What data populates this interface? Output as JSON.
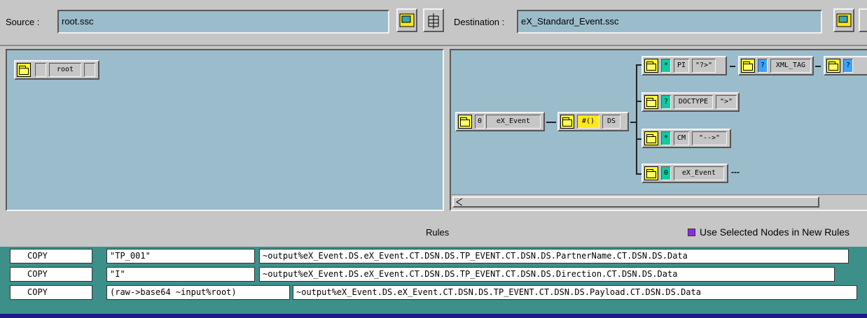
{
  "source": {
    "label": "Source :",
    "value": "root.ssc"
  },
  "destination": {
    "label": "Destination :",
    "value": "eX_Standard_Event.ssc"
  },
  "source_tree": {
    "root_label": "root"
  },
  "dest_tree": {
    "root": {
      "count": "0",
      "label": "eX_Event"
    },
    "ds": {
      "mark": "#()",
      "label": "DS"
    },
    "pi": {
      "mark": "*",
      "label": "PI",
      "value": "\"?>\""
    },
    "xml_tag": {
      "mark": "?",
      "label": "XML_TAG",
      "mark2": "?"
    },
    "doctype": {
      "mark": "?",
      "label": "DOCTYPE",
      "value": "\">\""
    },
    "cm": {
      "mark": "*",
      "label": "CM",
      "value": "\"-->\""
    },
    "child": {
      "count": "0",
      "label": "eX_Event",
      "ellipsis": "---"
    }
  },
  "rules": {
    "title": "Rules",
    "checkbox_label": "Use Selected Nodes in New Rules",
    "rows": [
      {
        "op": "COPY",
        "src": "\"TP_001\"",
        "dst": "~output%eX_Event.DS.eX_Event.CT.DSN.DS.TP_EVENT.CT.DSN.DS.PartnerName.CT.DSN.DS.Data"
      },
      {
        "op": "COPY",
        "src": "\"I\"",
        "dst": "~output%eX_Event.DS.eX_Event.CT.DSN.DS.TP_EVENT.CT.DSN.DS.Direction.CT.DSN.DS.Data"
      },
      {
        "op": "COPY",
        "src": "(raw->base64 ~input%root)",
        "dst": "~output%eX_Event.DS.eX_Event.CT.DSN.DS.TP_EVENT.CT.DSN.DS.Payload.CT.DSN.DS.Data"
      }
    ]
  },
  "colors": {
    "panel": "#9bbccb",
    "rules_bg": "#3d8f8a",
    "checkbox": "#8a2be2"
  }
}
